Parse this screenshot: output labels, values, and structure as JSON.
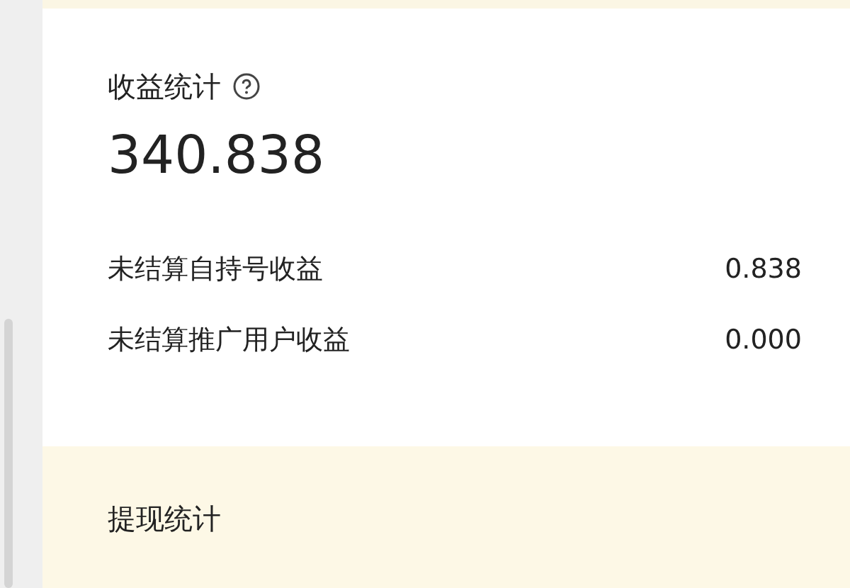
{
  "income_card": {
    "title": "收益统计",
    "help_icon": true,
    "total": "340.838",
    "rows": [
      {
        "label": "未结算自持号收益",
        "value": "0.838"
      },
      {
        "label": "未结算推广用户收益",
        "value": "0.000"
      }
    ]
  },
  "withdraw_card": {
    "title": "提现统计"
  }
}
